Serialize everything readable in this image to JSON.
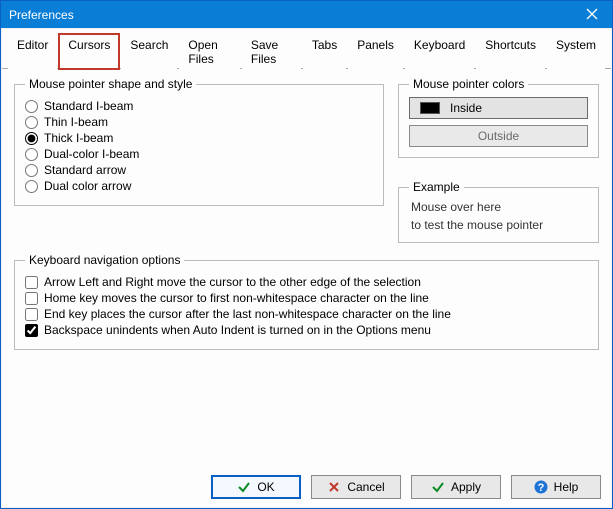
{
  "window": {
    "title": "Preferences"
  },
  "tabs": {
    "items": [
      {
        "label": "Editor"
      },
      {
        "label": "Cursors"
      },
      {
        "label": "Search"
      },
      {
        "label": "Open Files"
      },
      {
        "label": "Save Files"
      },
      {
        "label": "Tabs"
      },
      {
        "label": "Panels"
      },
      {
        "label": "Keyboard"
      },
      {
        "label": "Shortcuts"
      },
      {
        "label": "System"
      }
    ],
    "active_index": 1,
    "highlight_index": 1
  },
  "shape_group": {
    "legend": "Mouse pointer shape and style",
    "options": [
      {
        "label": "Standard I-beam"
      },
      {
        "label": "Thin I-beam"
      },
      {
        "label": "Thick I-beam"
      },
      {
        "label": "Dual-color I-beam"
      },
      {
        "label": "Standard arrow"
      },
      {
        "label": "Dual color arrow"
      }
    ],
    "selected_index": 2
  },
  "colors_group": {
    "legend": "Mouse pointer colors",
    "inside_label": "Inside",
    "outside_label": "Outside",
    "inside_color": "#000000"
  },
  "example_group": {
    "legend": "Example",
    "line1": "Mouse over here",
    "line2": "to test the mouse pointer"
  },
  "keyboard_group": {
    "legend": "Keyboard navigation options",
    "items": [
      {
        "label": "Arrow Left and Right move the cursor to the other edge of the selection",
        "checked": false
      },
      {
        "label": "Home key moves the cursor to first non-whitespace character on the line",
        "checked": false
      },
      {
        "label": "End key places the cursor after the last non-whitespace character on the line",
        "checked": false
      },
      {
        "label": "Backspace unindents when Auto Indent is turned on in the Options menu",
        "checked": true
      }
    ]
  },
  "buttons": {
    "ok": "OK",
    "cancel": "Cancel",
    "apply": "Apply",
    "help": "Help"
  }
}
